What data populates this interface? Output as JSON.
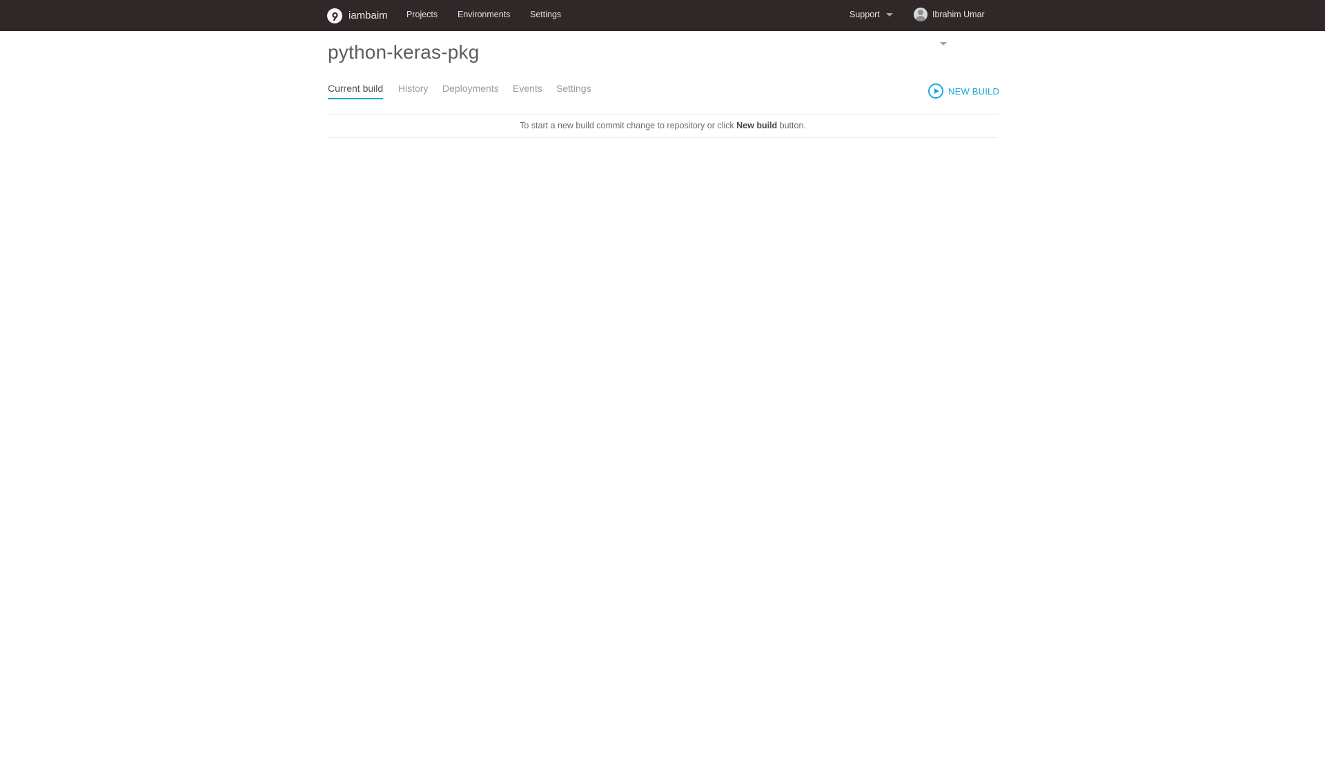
{
  "topbar": {
    "brand": "iambaim",
    "nav": [
      "Projects",
      "Environments",
      "Settings"
    ],
    "support": "Support",
    "user": "Ibrahim Umar"
  },
  "page": {
    "title": "python-keras-pkg",
    "tabs": [
      "Current build",
      "History",
      "Deployments",
      "Events",
      "Settings"
    ],
    "active_tab": "Current build",
    "new_build_label": "NEW BUILD"
  },
  "message": {
    "before": "To start a new build commit change to repository or click",
    "bold": "New build",
    "after": "button."
  },
  "colors": {
    "topbar_bg": "#302828",
    "accent": "#1aa7d8"
  }
}
